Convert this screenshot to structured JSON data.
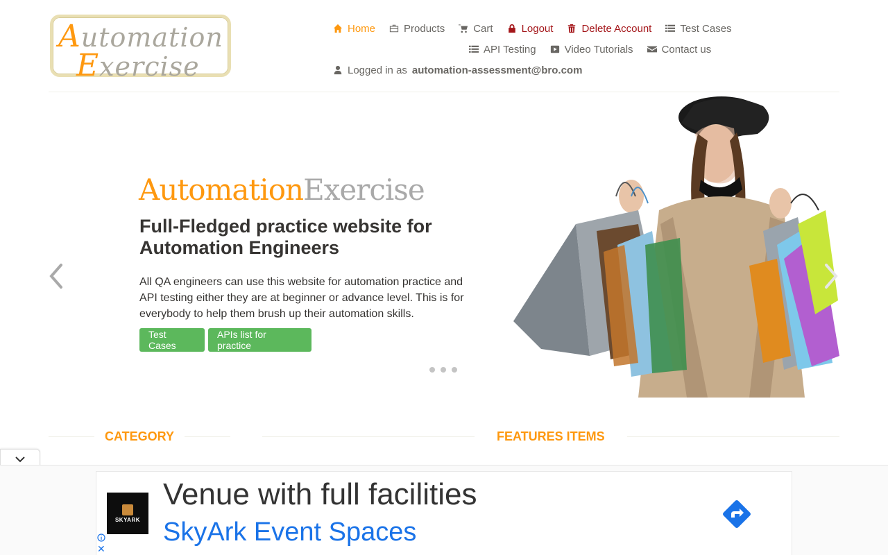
{
  "logo": {
    "line1_cap": "A",
    "line1_rest": "utomation",
    "line2_cap": "E",
    "line2_rest": "xercise"
  },
  "nav": {
    "row1": [
      {
        "label": "Home",
        "icon": "home-icon",
        "state": "active"
      },
      {
        "label": "Products",
        "icon": "briefcase-icon"
      },
      {
        "label": "Cart",
        "icon": "cart-icon"
      },
      {
        "label": "Logout",
        "icon": "lock-icon",
        "state": "danger"
      },
      {
        "label": "Delete Account",
        "icon": "trash-icon",
        "state": "danger"
      },
      {
        "label": "Test Cases",
        "icon": "list-icon"
      }
    ],
    "row2": [
      {
        "label": "API Testing",
        "icon": "list-icon"
      },
      {
        "label": "Video Tutorials",
        "icon": "youtube-icon"
      },
      {
        "label": "Contact us",
        "icon": "envelope-icon"
      }
    ],
    "logged_in_prefix": "Logged in as",
    "logged_in_user": "automation-assessment@bro.com"
  },
  "hero": {
    "brand_a": "Automation",
    "brand_b": "Exercise",
    "heading": "Full-Fledged practice website for Automation Engineers",
    "text": "All QA engineers can use this website for automation practice and API testing either they are at beginner or advance level. This is for everybody to help them brush up their automation skills.",
    "btn_test_cases": "Test Cases",
    "btn_apis": "APIs list for practice",
    "slide_count": 3
  },
  "sections": {
    "category": "CATEGORY",
    "features": "FEATURES ITEMS"
  },
  "ad": {
    "headline": "Venue with full facilities",
    "brand": "SkyArk Event Spaces",
    "logo_text": "SKYARK",
    "close": "✕"
  },
  "colors": {
    "accent": "#fe980f",
    "danger": "#a4161a",
    "button": "#5cb85c",
    "ad_link": "#1a73e8"
  }
}
